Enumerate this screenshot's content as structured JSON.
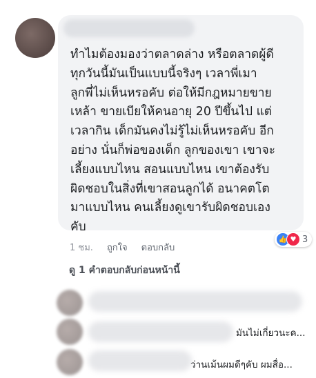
{
  "comment": {
    "text": "ทำไมต้องมองว่าตลาดล่าง หรือตลาดผู้ดี\nทุกวันนี้มันเป็นแบบนี้จริงๆ เวลาพี่เมา\nลูกพี่ไม่เห็นหรอคับ ต่อให้มีกฎหมายขาย\nเหล้า ขายเบียให้คนอายุ 20 ปีขึ้นไป แต่\nเวลากิน เด็กมันคงไม่รู้ไม่เห็นหรอคับ อีก\nอย่าง นั่นก็พ่อของเด็ก ลูกของเขา เขาจะ\nเลี้ยงแบบไหน สอนแบบไหน เขาต้องรับ\nผิดชอบในสิ่งที่เขาสอนลูกได้ อนาคตโต\nมาแบบไหน คนเลี้ยงดูเขารับผิดชอบเอง\nคับ",
    "time": "1 ชม.",
    "like_label": "ถูกใจ",
    "reply_label": "ตอบกลับ",
    "reaction_count": "3",
    "reaction_icons": [
      "like-icon",
      "love-icon"
    ]
  },
  "replies": {
    "previous_label": "ดู 1 คำตอบกลับก่อนหน้านี้",
    "snippet_1": "มันไม่เกี่ยวนะค...",
    "snippet_2": "ว่านเม้นผมดีๆคับ ผมสื่อ..."
  },
  "colors": {
    "bubble": "#f2f3f5",
    "like": "#3b82f6",
    "love": "#f0284a"
  }
}
